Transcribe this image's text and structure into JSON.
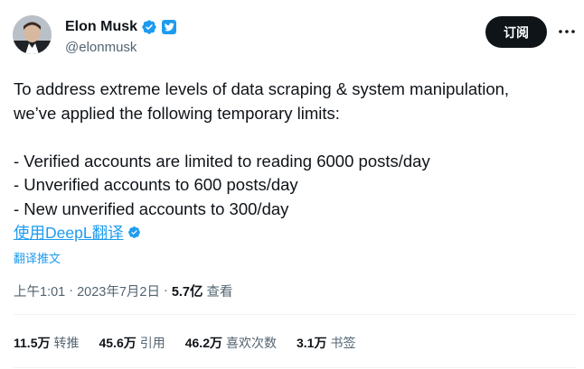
{
  "author": {
    "display_name": "Elon Musk",
    "handle": "@elonmusk"
  },
  "header": {
    "subscribe_label": "订阅",
    "more_icon": "more-horizontal-icon"
  },
  "tweet": {
    "lines": [
      "To address extreme levels of data scraping & system manipulation,",
      "we’ve applied the following temporary limits:",
      "",
      "- Verified accounts are limited to reading 6000 posts/day",
      "- Unverified accounts to 600 posts/day",
      "- New unverified accounts to 300/day"
    ],
    "translate_with_deepl": "使用DeepL翻译",
    "translate_post": "翻译推文"
  },
  "meta": {
    "time": "上午1:01",
    "separator": "·",
    "date": "2023年7月2日",
    "views_count": "5.7亿",
    "views_label": "查看"
  },
  "stats": [
    {
      "count": "11.5万",
      "label": "转推"
    },
    {
      "count": "45.6万",
      "label": "引用"
    },
    {
      "count": "46.2万",
      "label": "喜欢次数"
    },
    {
      "count": "3.1万",
      "label": "书签"
    }
  ],
  "colors": {
    "accent": "#1d9bf0",
    "text_primary": "#0f1419",
    "text_secondary": "#536471",
    "divider": "#eff3f4",
    "button_bg": "#0f1419"
  }
}
